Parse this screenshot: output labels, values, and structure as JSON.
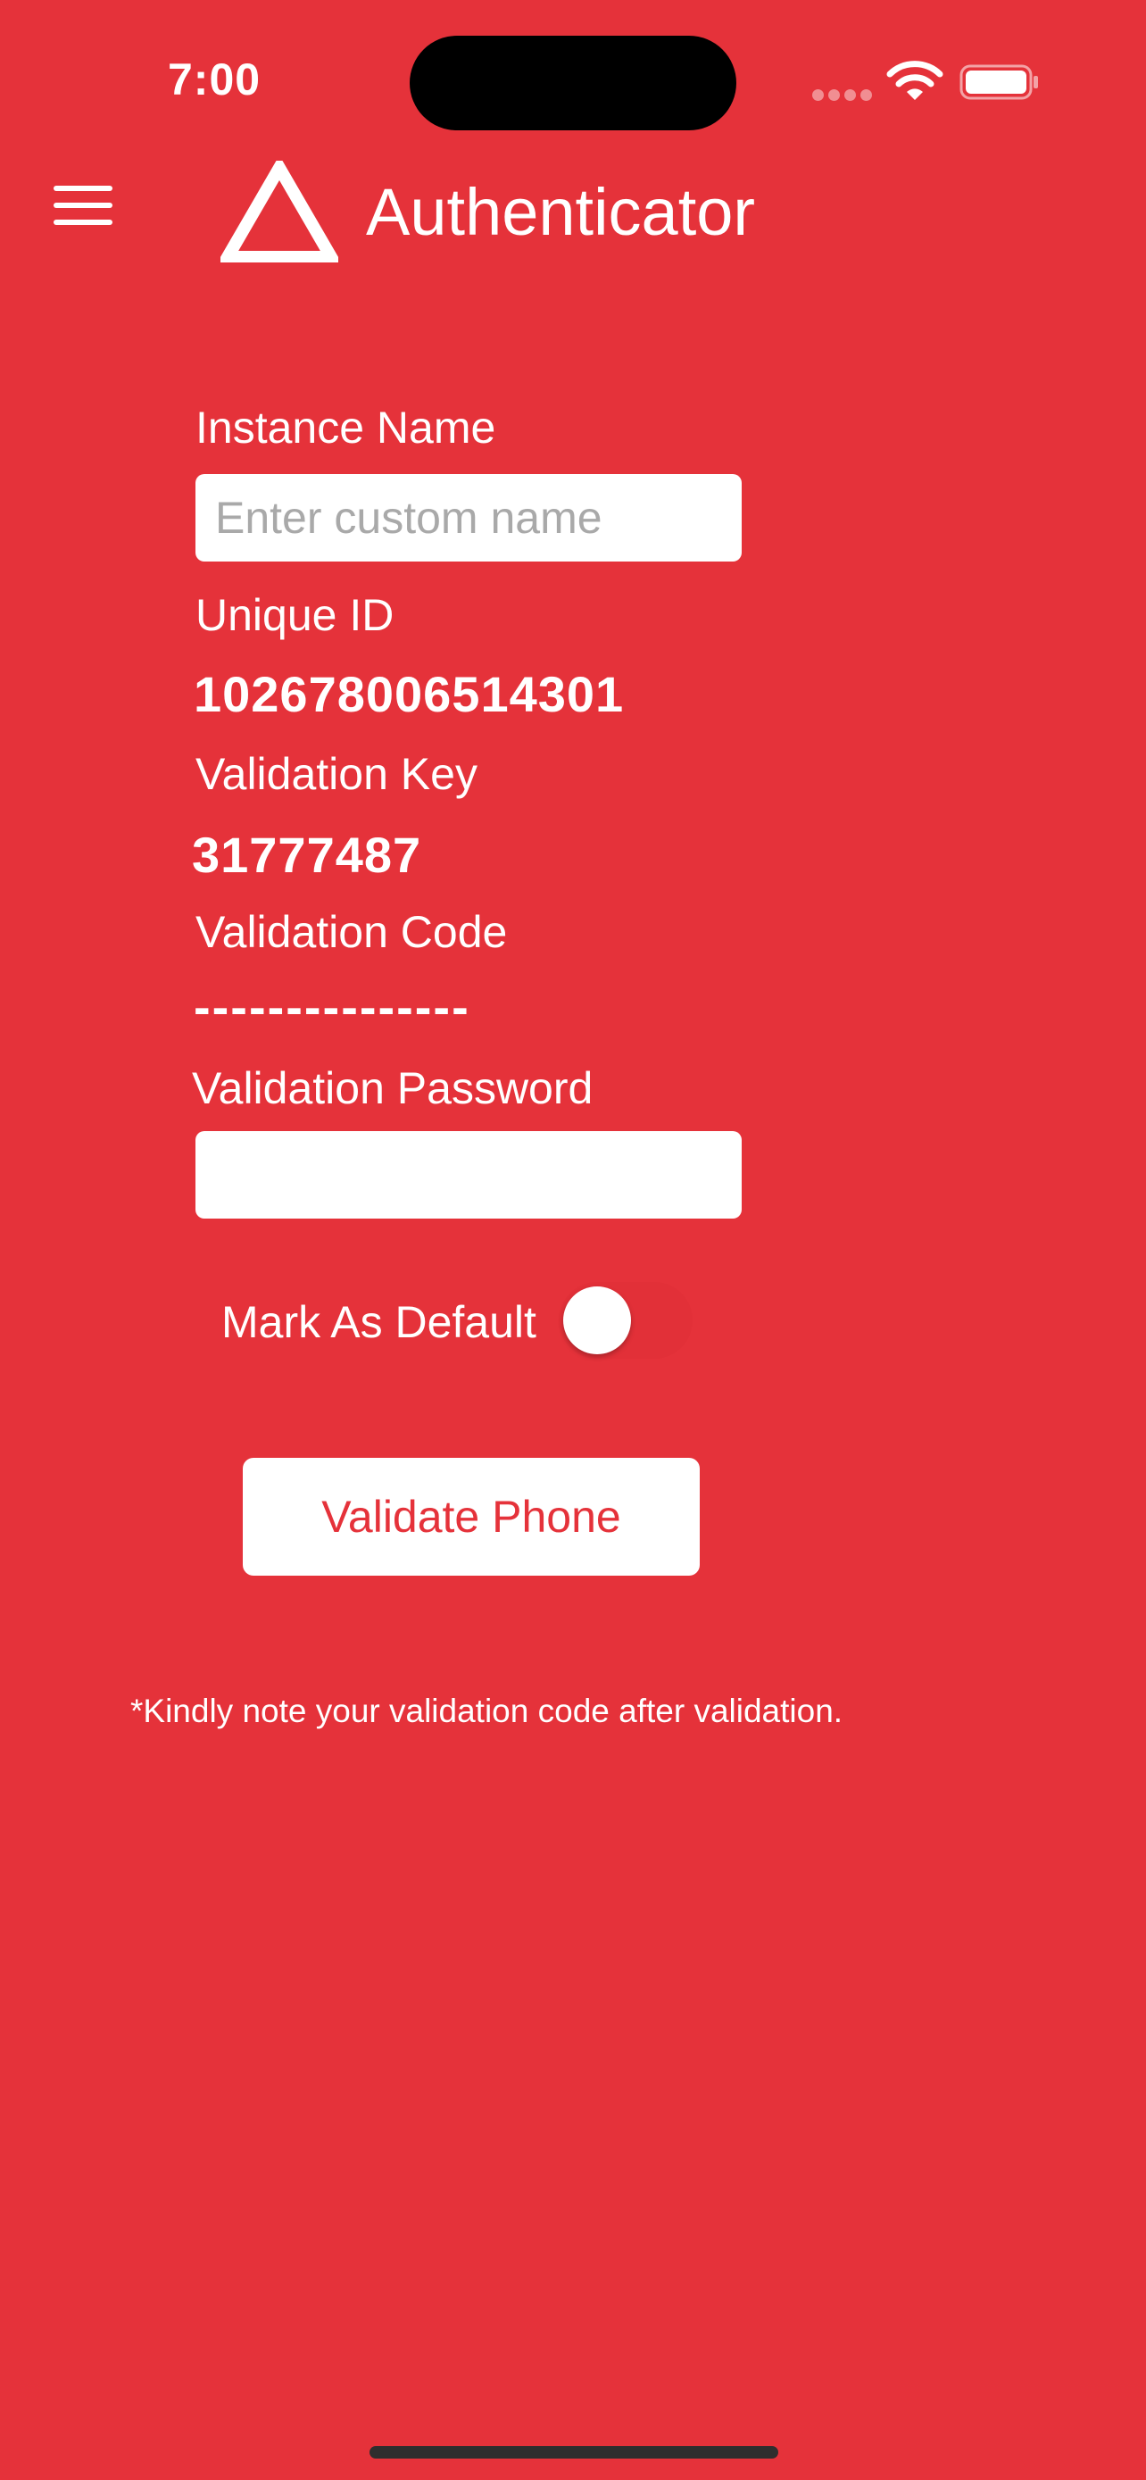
{
  "status_bar": {
    "time": "7:00"
  },
  "header": {
    "title": "Authenticator",
    "menu_icon": "hamburger-menu-icon",
    "logo_icon": "triangle-logo-icon"
  },
  "form": {
    "instance_name": {
      "label": "Instance Name",
      "placeholder": "Enter custom name",
      "value": ""
    },
    "unique_id": {
      "label": "Unique ID",
      "value": "102678006514301"
    },
    "validation_key": {
      "label": "Validation Key",
      "value": "31777487"
    },
    "validation_code": {
      "label": "Validation Code",
      "value": "---------------"
    },
    "validation_password": {
      "label": "Validation Password",
      "value": ""
    },
    "mark_default": {
      "label": "Mark As Default",
      "on": false
    },
    "validate_button": "Validate Phone"
  },
  "note": "*Kindly note your validation code after validation.",
  "colors": {
    "background": "#E5323A",
    "text": "#FFFFFF",
    "button_text": "#E5323A"
  }
}
